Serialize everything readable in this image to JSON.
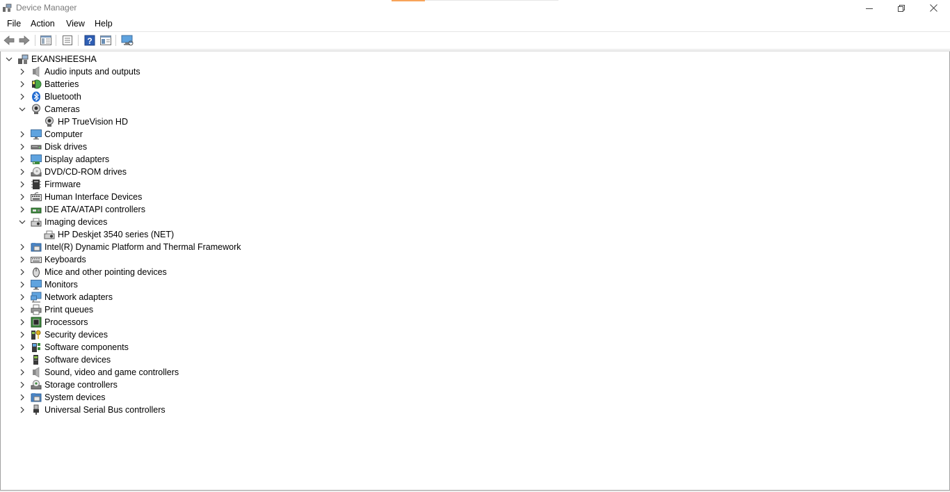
{
  "window": {
    "title": "Device Manager",
    "accent_color": "#f7a45a"
  },
  "menu": {
    "file": "File",
    "action": "Action",
    "view": "View",
    "help": "Help"
  },
  "toolbar": {
    "icons": [
      "back-arrow-icon",
      "forward-arrow-icon",
      "show-hide-console-tree-icon",
      "properties-icon",
      "help-icon",
      "run-view-icon",
      "scan-hardware-changes-monitor-icon"
    ]
  },
  "tree": {
    "root": {
      "label": "EKANSHEESHA",
      "expanded": true,
      "icon": "computer-tower-icon"
    },
    "categories": [
      {
        "label": "Audio inputs and outputs",
        "expanded": false,
        "icon": "speaker-icon"
      },
      {
        "label": "Batteries",
        "expanded": false,
        "icon": "battery-icon"
      },
      {
        "label": "Bluetooth",
        "expanded": false,
        "icon": "bluetooth-icon"
      },
      {
        "label": "Cameras",
        "expanded": true,
        "icon": "webcam-icon",
        "children": [
          "HP TrueVision HD"
        ]
      },
      {
        "label": "Computer",
        "expanded": false,
        "icon": "monitor-icon"
      },
      {
        "label": "Disk drives",
        "expanded": false,
        "icon": "disk-drive-icon"
      },
      {
        "label": "Display adapters",
        "expanded": false,
        "icon": "display-adapter-icon"
      },
      {
        "label": "DVD/CD-ROM drives",
        "expanded": false,
        "icon": "optical-drive-icon"
      },
      {
        "label": "Firmware",
        "expanded": false,
        "icon": "chip-icon"
      },
      {
        "label": "Human Interface Devices",
        "expanded": false,
        "icon": "hid-icon"
      },
      {
        "label": "IDE ATA/ATAPI controllers",
        "expanded": false,
        "icon": "ide-controller-icon"
      },
      {
        "label": "Imaging devices",
        "expanded": true,
        "icon": "imaging-device-icon",
        "children": [
          "HP Deskjet 3540 series (NET)"
        ]
      },
      {
        "label": "Intel(R) Dynamic Platform and Thermal Framework",
        "expanded": false,
        "icon": "system-folder-icon"
      },
      {
        "label": "Keyboards",
        "expanded": false,
        "icon": "keyboard-icon"
      },
      {
        "label": "Mice and other pointing devices",
        "expanded": false,
        "icon": "mouse-icon"
      },
      {
        "label": "Monitors",
        "expanded": false,
        "icon": "monitor-icon"
      },
      {
        "label": "Network adapters",
        "expanded": false,
        "icon": "network-icon"
      },
      {
        "label": "Print queues",
        "expanded": false,
        "icon": "printer-icon"
      },
      {
        "label": "Processors",
        "expanded": false,
        "icon": "processor-icon"
      },
      {
        "label": "Security devices",
        "expanded": false,
        "icon": "security-key-icon"
      },
      {
        "label": "Software components",
        "expanded": false,
        "icon": "software-component-icon"
      },
      {
        "label": "Software devices",
        "expanded": false,
        "icon": "software-device-icon"
      },
      {
        "label": "Sound, video and game controllers",
        "expanded": false,
        "icon": "speaker-icon"
      },
      {
        "label": "Storage controllers",
        "expanded": false,
        "icon": "storage-controller-icon"
      },
      {
        "label": "System devices",
        "expanded": false,
        "icon": "system-folder-icon"
      },
      {
        "label": "Universal Serial Bus controllers",
        "expanded": false,
        "icon": "usb-icon"
      }
    ]
  }
}
